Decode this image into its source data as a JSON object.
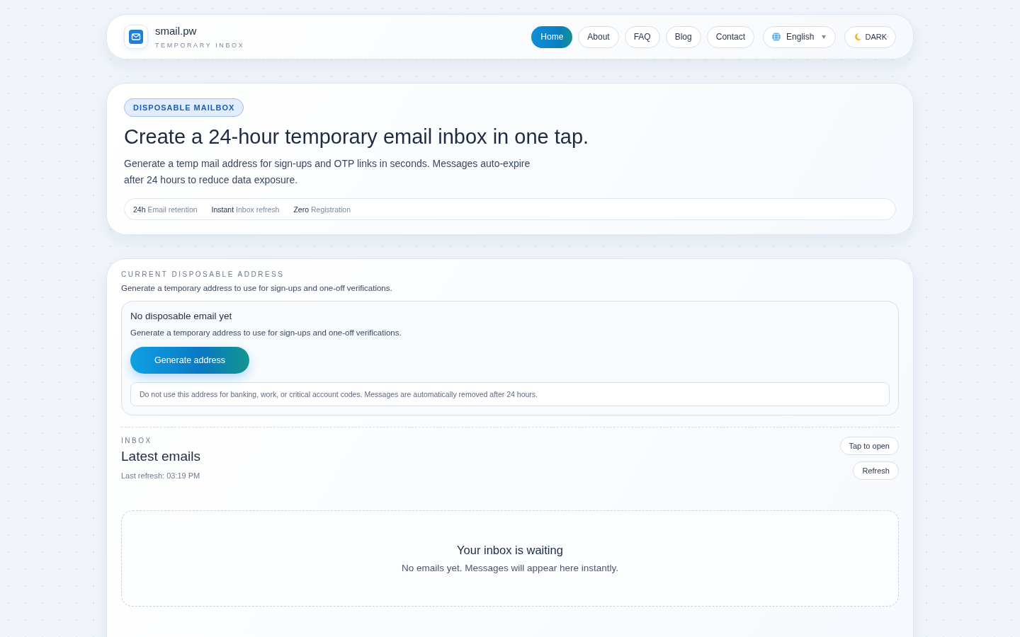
{
  "brand": {
    "name": "smail.pw",
    "tagline": "TEMPORARY INBOX"
  },
  "nav": [
    {
      "label": "Home",
      "selected": true
    },
    {
      "label": "About",
      "selected": false
    },
    {
      "label": "FAQ",
      "selected": false
    },
    {
      "label": "Blog",
      "selected": false
    },
    {
      "label": "Contact",
      "selected": false
    }
  ],
  "language": {
    "value": "English"
  },
  "theme_toggle": {
    "label": "DARK"
  },
  "hero": {
    "badge": "DISPOSABLE MAILBOX",
    "title": "Create a 24-hour temporary email inbox in one tap.",
    "description": "Generate a temp mail address for sign-ups and OTP links in seconds. Messages auto-expire after 24 hours to reduce data exposure.",
    "stats": [
      {
        "value": "24h",
        "label": "Email retention"
      },
      {
        "value": "Instant",
        "label": "Inbox refresh"
      },
      {
        "value": "Zero",
        "label": "Registration"
      }
    ]
  },
  "address": {
    "eyebrow": "CURRENT DISPOSABLE ADDRESS",
    "intro": "Generate a temporary address to use for sign-ups and one-off verifications.",
    "empty_title": "No disposable email yet",
    "empty_text": "Generate a temporary address to use for sign-ups and one-off verifications.",
    "button": "Generate address",
    "warning": "Do not use this address for banking, work, or critical account codes. Messages are automatically removed after 24 hours."
  },
  "inbox": {
    "eyebrow": "INBOX",
    "title": "Latest emails",
    "last_refresh": "Last refresh: 03:19 PM",
    "buttons": [
      "Tap to open",
      "Refresh"
    ],
    "empty_title": "Your inbox is waiting",
    "empty_text": "No emails yet. Messages will appear here instantly."
  }
}
